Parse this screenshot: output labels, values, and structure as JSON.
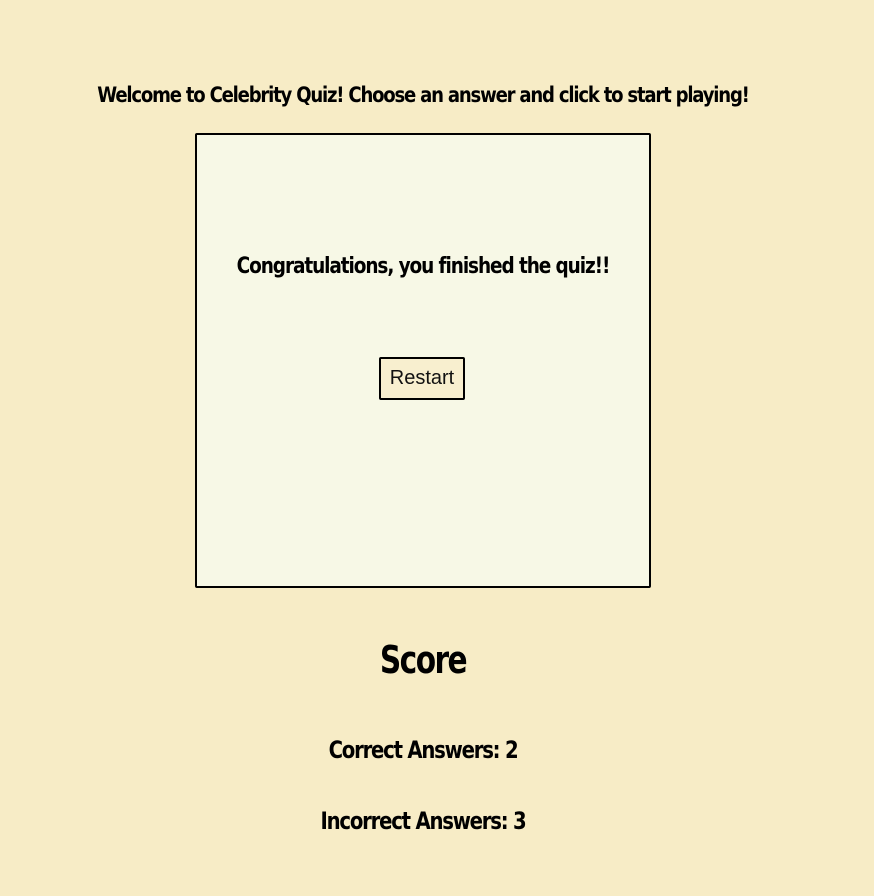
{
  "header": {
    "welcome_text": "Welcome to Celebrity Quiz! Choose an answer and click to start playing!"
  },
  "quiz": {
    "finish_message": "Congratulations, you finished the quiz!!",
    "restart_label": "Restart"
  },
  "score": {
    "heading": "Score",
    "correct_text": "Correct Answers: 2",
    "incorrect_text": "Incorrect Answers: 3"
  },
  "colors": {
    "page_background": "#f7ecc6",
    "quiz_box_background": "#f7f8e6",
    "button_background": "#f8efcf",
    "border": "#000000"
  }
}
